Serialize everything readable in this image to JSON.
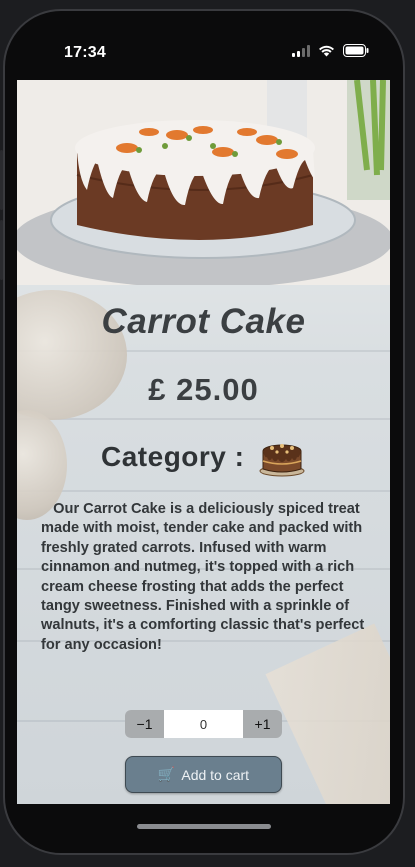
{
  "status_bar": {
    "time": "17:34",
    "icons": [
      "signal-icon",
      "wifi-icon",
      "battery-icon"
    ]
  },
  "product": {
    "name": "Carrot Cake",
    "price": "£ 25.00",
    "category_label": "Category :",
    "category_icon": "chocolate-cake-icon",
    "description": "   Our Carrot Cake is a deliciously spiced treat made with moist, tender cake and packed with freshly grated carrots. Infused with warm cinnamon and nutmeg, it's topped with a rich cream cheese frosting that adds the perfect tangy sweetness. Finished with a sprinkle of walnuts, it's a comforting classic that's perfect for any occasion!"
  },
  "stepper": {
    "decrement_label": "−1",
    "quantity": "0",
    "increment_label": "+1"
  },
  "cart_button": {
    "icon": "🛒",
    "label": "Add to cart"
  },
  "colors": {
    "text_dark": "#3b3f42",
    "button_bg": "#6a7f8e",
    "stepper_btn": "#a9acae"
  }
}
